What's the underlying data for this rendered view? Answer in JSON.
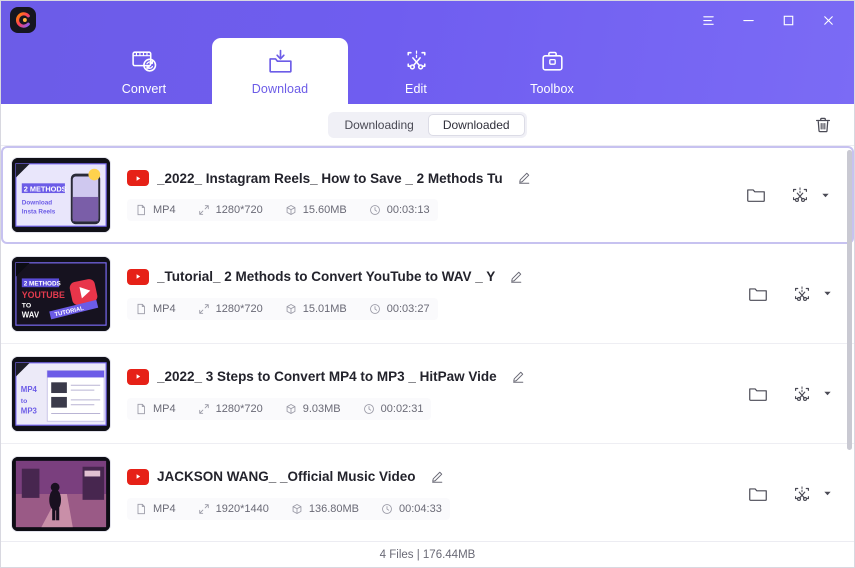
{
  "window": {
    "logo_icon": "hitpaw-logo-icon",
    "controls": [
      {
        "name": "menu-button",
        "icon": "hamburger-menu-icon"
      },
      {
        "name": "minimize-button",
        "icon": "minimize-icon"
      },
      {
        "name": "maximize-button",
        "icon": "maximize-icon"
      },
      {
        "name": "close-button",
        "icon": "close-icon"
      }
    ]
  },
  "colors": {
    "header_gradient_start": "#6c5ce7",
    "header_gradient_end": "#7b6bf5",
    "accent": "#6c5ce7",
    "youtube_red": "#e62117",
    "selected_border": "#c7c2f0"
  },
  "tabs": [
    {
      "label": "Convert",
      "icon": "film-convert-icon",
      "active": false
    },
    {
      "label": "Download",
      "icon": "folder-download-icon",
      "active": true
    },
    {
      "label": "Edit",
      "icon": "scissors-frame-icon",
      "active": false
    },
    {
      "label": "Toolbox",
      "icon": "briefcase-icon",
      "active": false
    }
  ],
  "toolbar": {
    "segments": [
      {
        "label": "Downloading",
        "active": false
      },
      {
        "label": "Downloaded",
        "active": true
      }
    ],
    "delete_all_icon": "trash-icon"
  },
  "list": {
    "rows": [
      {
        "title": "_2022_ Instagram Reels_ How to Save _ 2 Methods Tu",
        "source_icon": "youtube-icon",
        "format": "MP4",
        "resolution": "1280*720",
        "size": "15.60MB",
        "duration": "00:03:13",
        "selected": true,
        "thumb": "instagram-reels-thumbnail"
      },
      {
        "title": "_Tutorial_ 2 Methods to Convert YouTube to WAV _ Y",
        "source_icon": "youtube-icon",
        "format": "MP4",
        "resolution": "1280*720",
        "size": "15.01MB",
        "duration": "00:03:27",
        "selected": false,
        "thumb": "youtube-to-wav-thumbnail"
      },
      {
        "title": "_2022_ 3 Steps to Convert MP4 to MP3 _ HitPaw Vide",
        "source_icon": "youtube-icon",
        "format": "MP4",
        "resolution": "1280*720",
        "size": "9.03MB",
        "duration": "00:02:31",
        "selected": false,
        "thumb": "mp4-to-mp3-thumbnail"
      },
      {
        "title": "JACKSON WANG_ _Official Music Video",
        "source_icon": "youtube-icon",
        "format": "MP4",
        "resolution": "1920*1440",
        "size": "136.80MB",
        "duration": "00:04:33",
        "selected": false,
        "thumb": "jackson-wang-thumbnail"
      }
    ],
    "row_actions": {
      "open_folder_icon": "folder-icon",
      "edit_icon": "scissors-edit-icon",
      "more_icon": "chevron-down-icon",
      "rename_icon": "pencil-icon"
    },
    "meta_icons": {
      "format": "file-icon",
      "resolution": "resize-icon",
      "size": "box-icon",
      "duration": "clock-icon"
    }
  },
  "footer": {
    "status": "4 Files | 176.44MB"
  }
}
